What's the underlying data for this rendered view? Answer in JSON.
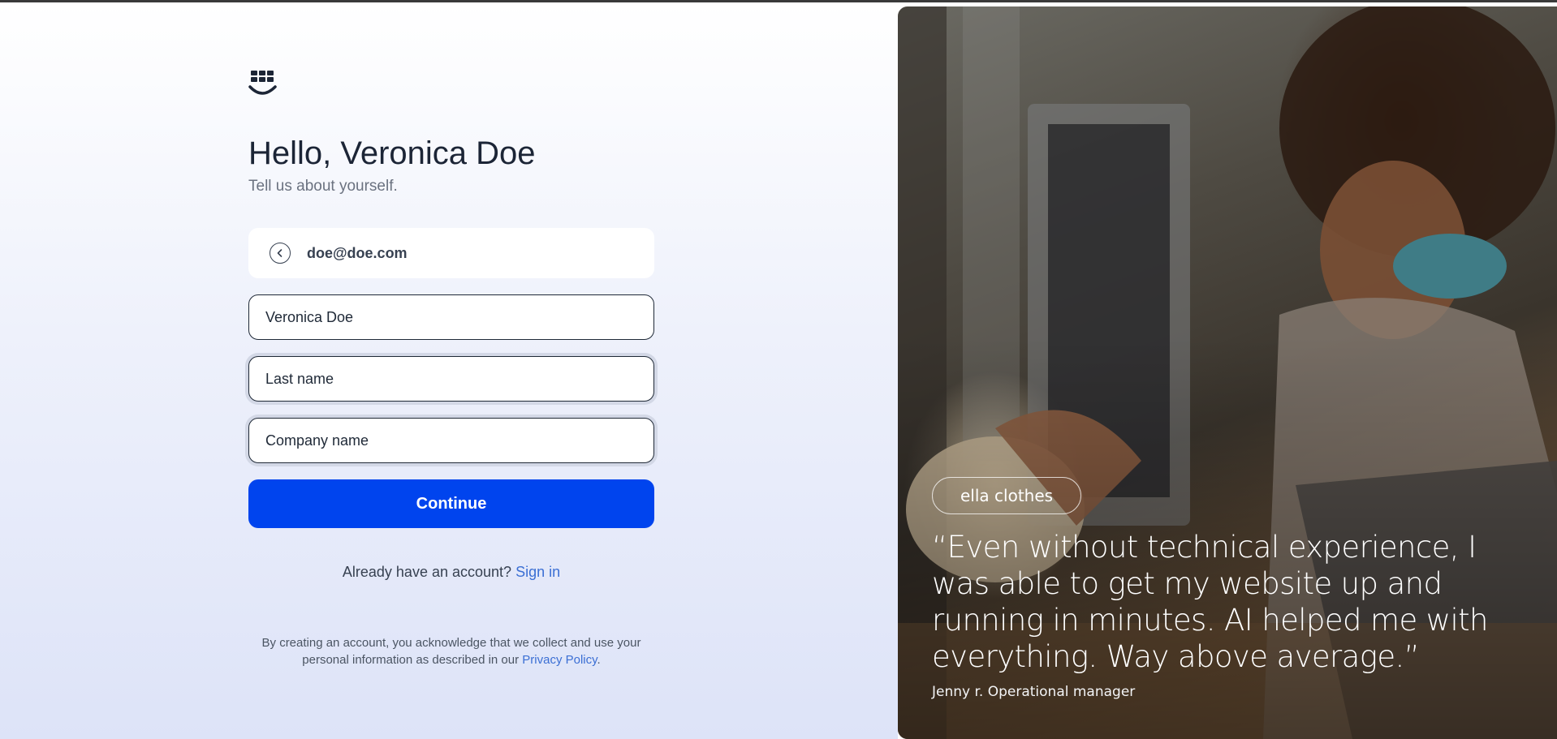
{
  "header": {
    "title": "Hello, Veronica Doe",
    "subtitle": "Tell us about yourself."
  },
  "account": {
    "email": "doe@doe.com"
  },
  "form": {
    "first_name_value": "Veronica Doe",
    "last_name_placeholder": "Last name",
    "company_placeholder": "Company name",
    "continue_label": "Continue"
  },
  "signin": {
    "prompt": "Already have an account?",
    "link_label": "Sign in"
  },
  "legal": {
    "text": "By creating an account, you acknowledge that we collect and use your personal information as described in our",
    "link_label": "Privacy Policy",
    "suffix": "."
  },
  "testimonial": {
    "brand": "ella clothes",
    "quote": "“Even without technical experience, I was able to get my website up and running in minutes. AI helped me with everything. Way above average.”",
    "author": "Jenny r. Operational manager"
  },
  "colors": {
    "accent": "#0044ee",
    "link": "#3b6fd4"
  }
}
